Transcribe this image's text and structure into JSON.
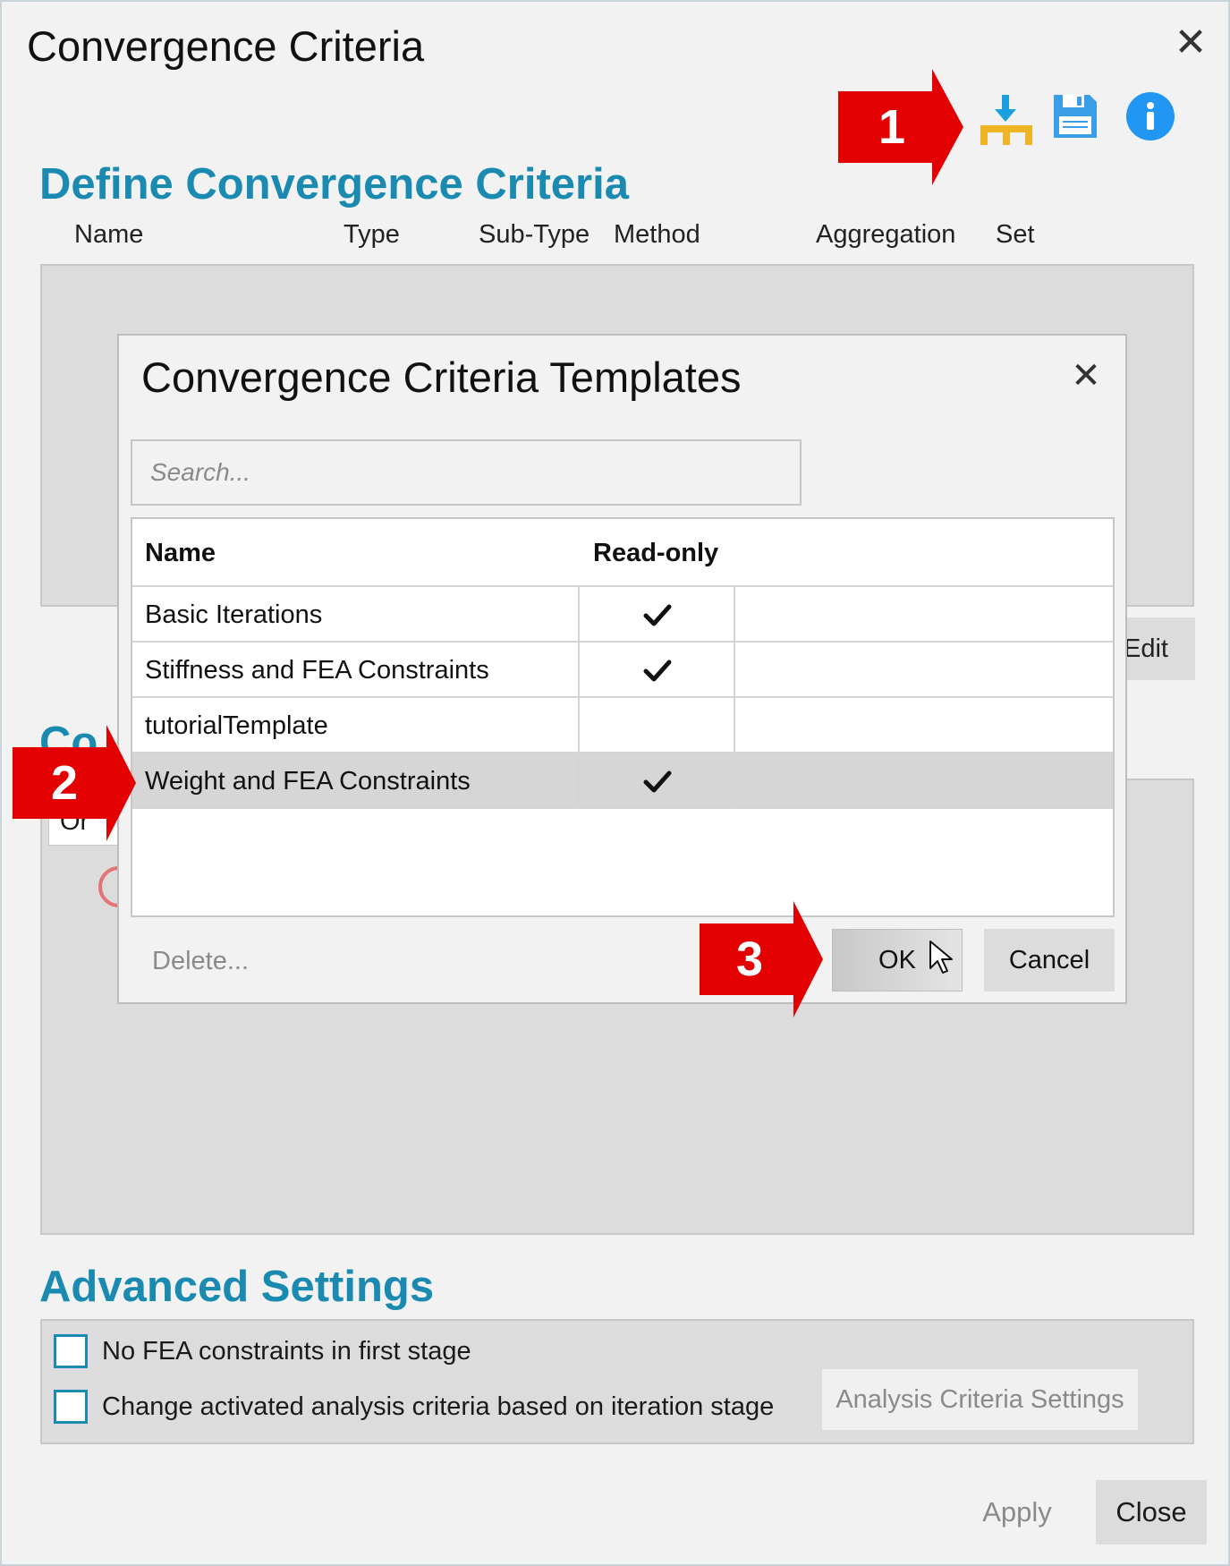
{
  "window": {
    "title": "Convergence Criteria",
    "close_icon": "close-icon"
  },
  "toolbar": {
    "icons": [
      "import-template-icon",
      "save-icon",
      "info-icon"
    ],
    "colors": {
      "import_arrow": "#1a9fe0",
      "import_base": "#f0b323",
      "save": "#3a9ee6",
      "info": "#2196f3"
    }
  },
  "define_section": {
    "heading": "Define Convergence Criteria",
    "columns": [
      "Name",
      "Type",
      "Sub-Type",
      "Method",
      "Aggregation",
      "Set"
    ],
    "edit_label_partial": "Edit"
  },
  "second_section": {
    "heading_partial": "Co",
    "field_partial": "Or"
  },
  "advanced": {
    "heading": "Advanced Settings",
    "option1": "No FEA constraints in first stage",
    "option2": "Change activated analysis criteria based on iteration stage",
    "criteria_button": "Analysis Criteria Settings"
  },
  "footer": {
    "apply": "Apply",
    "close": "Close"
  },
  "modal": {
    "title": "Convergence Criteria Templates",
    "search_placeholder": "Search...",
    "columns": {
      "name": "Name",
      "readonly": "Read-only"
    },
    "rows": [
      {
        "name": "Basic Iterations",
        "readonly": true
      },
      {
        "name": "Stiffness and FEA Constraints",
        "readonly": true
      },
      {
        "name": "tutorialTemplate",
        "readonly": false
      },
      {
        "name": "Weight and FEA Constraints",
        "readonly": true,
        "selected": true
      }
    ],
    "delete": "Delete...",
    "ok": "OK",
    "cancel": "Cancel"
  },
  "callouts": {
    "one": "1",
    "two": "2",
    "three": "3",
    "color": "#e30000"
  },
  "colors": {
    "accent": "#1a8ab0",
    "window_bg": "#f2f2f2",
    "panel_bg": "#dcdcdc"
  }
}
